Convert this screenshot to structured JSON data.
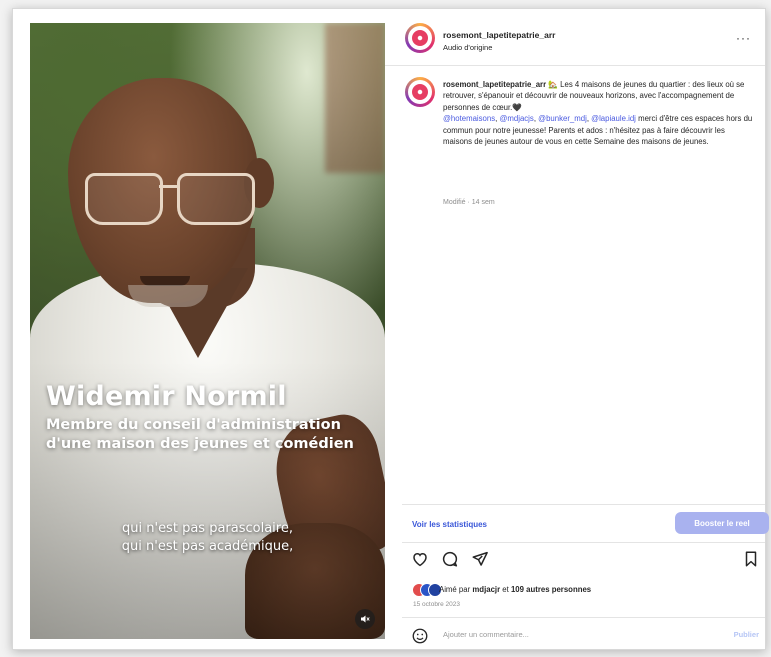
{
  "post": {
    "username": "rosemont_lapetitepatrie_arr",
    "audio": "Audio d'origine",
    "more": "···"
  },
  "video": {
    "name": "Widemir Normil",
    "role_line1": "Membre du conseil d'administration",
    "role_line2": "d'une maison des jeunes et comédien",
    "caption_line1": "qui n'est pas parascolaire,",
    "caption_line2": "qui n'est pas académique,"
  },
  "caption": {
    "username": "rosemont_lapetitepatrie_arr",
    "text1": " 🏡 Les 4 maisons de jeunes du quartier : des lieux où se retrouver, s'épanouir et découvrir de nouveaux horizons, avec l'accompagnement de personnes de cœur.🖤",
    "mention1": "@hotemaisons",
    "mention2": "@mdjacjs",
    "mention3": "@bunker_mdj",
    "mention4": "@lapiaule.idj",
    "text2": " merci d'être ces espaces hors du commun pour notre jeunesse! Parents et ados : n'hésitez pas à faire découvrir les maisons de jeunes autour de vous en cette Semaine des maisons de jeunes.",
    "time": "Modifié · 14 sem"
  },
  "actions": {
    "stats": "Voir les statistiques",
    "boost": "Booster le reel"
  },
  "likes": {
    "prefix": "Aimé par ",
    "user": "mdjacjr",
    "middle": " et ",
    "others": "109 autres personnes",
    "date": "15 octobre 2023"
  },
  "comment": {
    "placeholder": "Ajouter un commentaire...",
    "publish": "Publier"
  },
  "colors": {
    "link": "#3a57d8",
    "boost": "#a9b2ef",
    "publish": "#b6c6f5"
  }
}
